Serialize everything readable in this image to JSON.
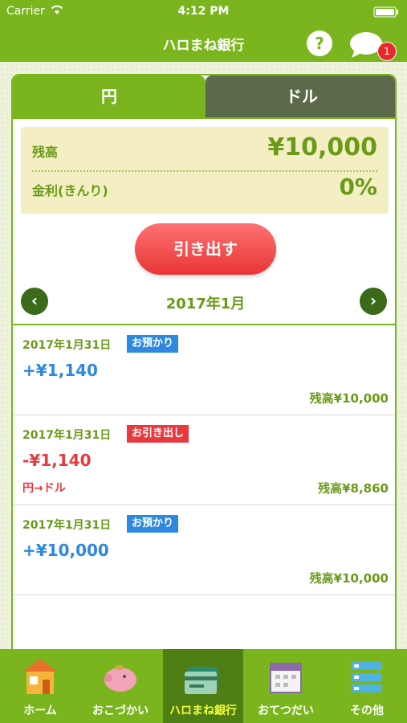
{
  "status_bar": {
    "carrier": "Carrier",
    "time": "4:12 PM"
  },
  "nav": {
    "title": "ハロまね銀行",
    "help_label": "?",
    "badge_count": "1"
  },
  "tabs": {
    "yen": "円",
    "dollar": "ドル"
  },
  "balance": {
    "balance_label": "残高",
    "balance_value": "¥10,000",
    "interest_label": "金利(きんり)",
    "interest_value": "0%"
  },
  "withdraw_label": "引き出す",
  "month": {
    "label": "2017年1月",
    "prev": "‹",
    "next": "›"
  },
  "transactions": [
    {
      "date": "2017年1月31日",
      "type": "お預かり",
      "amount": "+¥1,140",
      "note": "",
      "balance": "残高¥10,000"
    },
    {
      "date": "2017年1月31日",
      "type": "お引き出し",
      "amount": "-¥1,140",
      "note": "円→ドル",
      "balance": "残高¥8,860"
    },
    {
      "date": "2017年1月31日",
      "type": "お預かり",
      "amount": "+¥10,000",
      "note": "",
      "balance": "残高¥10,000"
    }
  ],
  "tab_bar": [
    {
      "label": "ホーム",
      "icon": "house-icon"
    },
    {
      "label": "おこづかい",
      "icon": "piggy-bank-icon"
    },
    {
      "label": "ハロまね銀行",
      "icon": "bank-card-icon",
      "active": true
    },
    {
      "label": "おてつだい",
      "icon": "calendar-icon"
    },
    {
      "label": "その他",
      "icon": "list-icon"
    }
  ],
  "colors": {
    "brand_green": "#7ab51d",
    "deposit_blue": "#2d88e0",
    "withdraw_red": "#e8393f"
  }
}
